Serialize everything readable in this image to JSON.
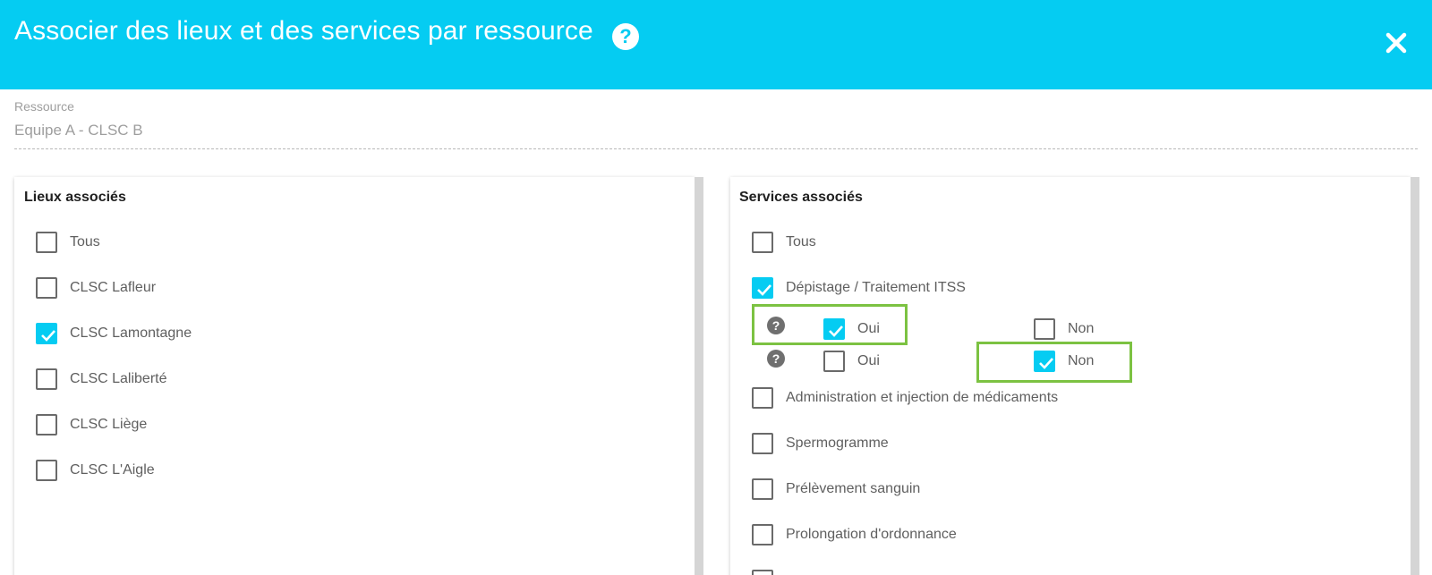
{
  "header": {
    "title": "Associer des lieux et des services par ressource",
    "help_icon": "?",
    "close_icon": "close-icon"
  },
  "resource": {
    "label": "Ressource",
    "value": "Equipe A - CLSC B"
  },
  "lieux": {
    "title": "Lieux associés",
    "items": [
      {
        "label": "Tous",
        "checked": false
      },
      {
        "label": "CLSC Lafleur",
        "checked": false
      },
      {
        "label": "CLSC Lamontagne",
        "checked": true
      },
      {
        "label": "CLSC Laliberté",
        "checked": false
      },
      {
        "label": "CLSC Liège",
        "checked": false
      },
      {
        "label": "CLSC L'Aigle",
        "checked": false
      }
    ]
  },
  "services": {
    "title": "Services associés",
    "items": [
      {
        "label": "Tous",
        "checked": false
      },
      {
        "label": "Dépistage / Traitement ITSS",
        "checked": true
      },
      {
        "label": "Administration et injection de médicaments",
        "checked": false
      },
      {
        "label": "Spermogramme",
        "checked": false
      },
      {
        "label": "Prélèvement sanguin",
        "checked": false
      },
      {
        "label": "Prolongation d'ordonnance",
        "checked": false
      }
    ],
    "sub_questions": [
      {
        "help": "?",
        "oui_label": "Oui",
        "oui_checked": true,
        "non_label": "Non",
        "non_checked": false
      },
      {
        "help": "?",
        "oui_label": "Oui",
        "oui_checked": false,
        "non_label": "Non",
        "non_checked": true
      }
    ]
  },
  "colors": {
    "accent": "#05ccf2",
    "highlight": "#7cc242"
  }
}
